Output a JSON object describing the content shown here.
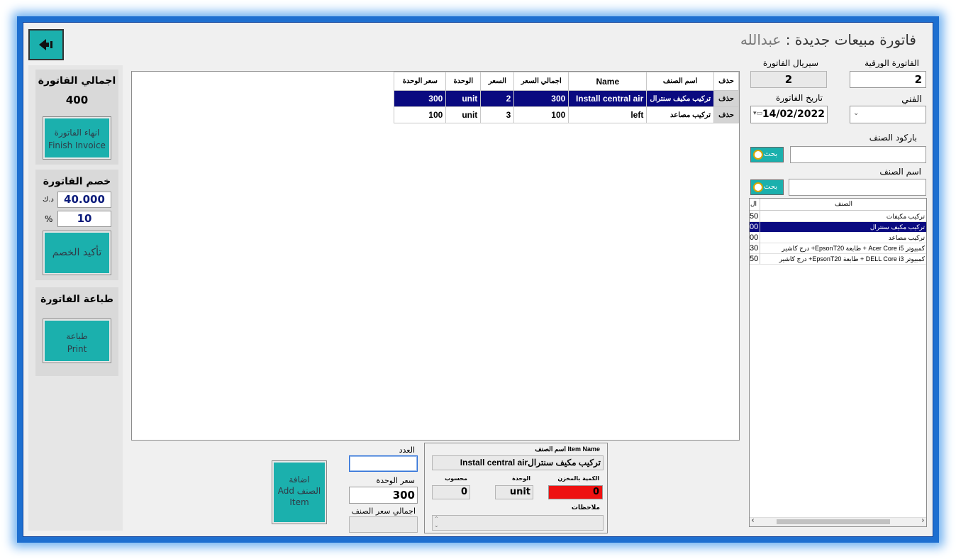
{
  "window": {
    "title": "فاتورة مبيعات جديدة :",
    "user": "عبدالله"
  },
  "back_button": {
    "icon": "back-arrow-icon"
  },
  "total_panel": {
    "title": "اجمالي الفاتورة",
    "value": "400",
    "finish_ar": "انهاء الفاتورة",
    "finish_en": "Finish Invoice"
  },
  "discount_panel": {
    "title": "خصم الفاتورة",
    "amount_unit": "د.ك",
    "amount": "40.000",
    "percent_unit": "%",
    "percent": "10",
    "confirm": "تأكيد الخصم"
  },
  "print_panel": {
    "title": "طباعة الفاتورة",
    "print_ar": "طباعة",
    "print_en": "Print"
  },
  "invoice_grid": {
    "headers": [
      "حذف",
      "اسم الصنف",
      "Name",
      "اجمالي السعر",
      "السعر",
      "الوحدة",
      "سعر الوحدة"
    ],
    "rows": [
      {
        "delete": "حذف",
        "name_ar": "تركيب مكيف سنترال",
        "name_en": "Install central air",
        "total": "300",
        "qty": "2",
        "unit": "unit",
        "unit_price": "300"
      },
      {
        "delete": "حذف",
        "name_ar": "تركيب مصاعد",
        "name_en": "left",
        "total": "100",
        "qty": "3",
        "unit": "unit",
        "unit_price": "100"
      }
    ]
  },
  "header_fields": {
    "paper_invoice_label": "الفاتورة الورقية",
    "paper_invoice_value": "2",
    "serial_label": "سيريال الفاتورة",
    "serial_value": "2",
    "technician_label": "الفني",
    "technician_value": "",
    "date_label": "تاريخ الفاتورة",
    "date_value": "14/02/2022",
    "barcode_label": "باركود الصنف",
    "barcode_value": "",
    "item_name_label": "اسم الصنف",
    "item_name_value": "",
    "search_label": "بحث"
  },
  "item_list": {
    "col_name": "الصنف",
    "col_price": "ال",
    "items": [
      {
        "name": "تركيب مكيفات",
        "price": "50"
      },
      {
        "name": "تركيب مكيف سنترال",
        "price": "00"
      },
      {
        "name": "تركيب مصاعد",
        "price": "00"
      },
      {
        "name": "كمبيوتر Acer Core i5 + طابعة EpsonT20+ درج كاشير",
        "price": "30"
      },
      {
        "name": "كمبيوتر DELL Core i3 + طابعة EpsonT20+ درج كاشير",
        "price": "50"
      }
    ]
  },
  "item_detail": {
    "name_label": "اسم الصنف Item Name",
    "name_value": "تركيب مكيف سنترالInstall central air",
    "stock_label": "الكمية بالمخزن",
    "stock_value": "0",
    "unit_label": "الوحدة",
    "unit_value": "unit",
    "calc_label": "محسوب",
    "calc_value": "0",
    "notes_label": "ملاحظات",
    "notes_value": ""
  },
  "add_form": {
    "qty_label": "العدد",
    "qty_value": "",
    "unit_price_label": "سعر الوحدة",
    "unit_price_value": "300",
    "total_label": "اجمالي سعر الصنف",
    "total_value": "",
    "add_ar": "اضافة",
    "add_ar2": "الصنف",
    "add_en": "Add",
    "add_en2": "Item"
  },
  "colors": {
    "frame": "#1e6fd0",
    "teal": "#1bb0ad",
    "selected_row": "#0a0a80",
    "stock_red": "#ee1111"
  }
}
